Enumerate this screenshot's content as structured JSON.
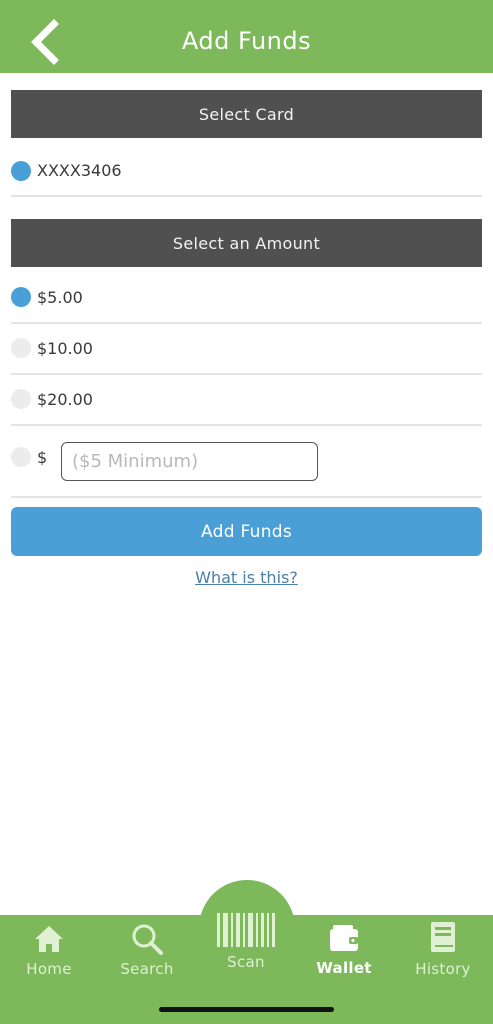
{
  "header": {
    "title": "Add Funds",
    "back_icon": "chevron-left-icon",
    "background": "#7db95a"
  },
  "card_section": {
    "title": "Select Card",
    "cards": [
      {
        "label": "XXXX3406",
        "selected": true
      }
    ]
  },
  "amount_section": {
    "title": "Select an Amount",
    "options": [
      {
        "label": "$5.00",
        "selected": true
      },
      {
        "label": "$10.00",
        "selected": false
      },
      {
        "label": "$20.00",
        "selected": false
      }
    ],
    "custom": {
      "currency_symbol": "$",
      "placeholder": "($5 Minimum)",
      "value": "",
      "selected": false
    }
  },
  "actions": {
    "add_funds_label": "Add Funds",
    "help_link_label": "What is this?",
    "button_color": "#4a9fd6"
  },
  "bottom_nav": {
    "items": [
      {
        "label": "Home",
        "icon": "home-icon",
        "active": false
      },
      {
        "label": "Search",
        "icon": "search-icon",
        "active": false
      },
      {
        "label": "Scan",
        "icon": "barcode-icon",
        "active": false
      },
      {
        "label": "Wallet",
        "icon": "wallet-icon",
        "active": true
      },
      {
        "label": "History",
        "icon": "book-icon",
        "active": false
      }
    ]
  }
}
